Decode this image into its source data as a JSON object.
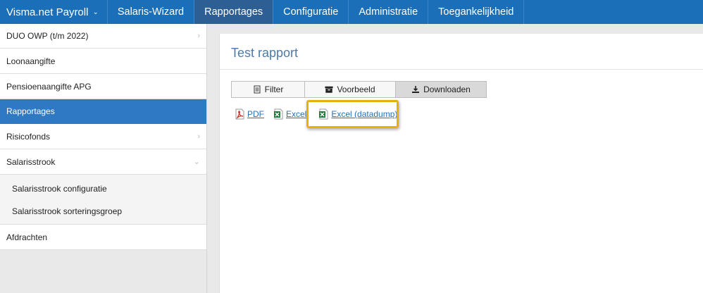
{
  "topnav": {
    "brand": "Visma.net Payroll",
    "items": [
      "Salaris-Wizard",
      "Rapportages",
      "Configuratie",
      "Administratie",
      "Toegankelijkheid"
    ],
    "active": "Rapportages"
  },
  "sidebar": {
    "items": [
      {
        "label": "DUO OWP (t/m 2022)",
        "caret": "›"
      },
      {
        "label": "Loonaangifte"
      },
      {
        "label": "Pensioenaangifte APG"
      },
      {
        "label": "Rapportages",
        "active": true
      },
      {
        "label": "Risicofonds",
        "caret": "›"
      },
      {
        "label": "Salarisstrook",
        "caret": "⌄"
      },
      {
        "label": "Afdrachten"
      }
    ],
    "subitems": [
      "Salarisstrook configuratie",
      "Salarisstrook sorteringsgroep"
    ]
  },
  "main": {
    "title": "Test rapport",
    "tabs": [
      {
        "label": "Filter",
        "icon": "document-icon"
      },
      {
        "label": "Voorbeeld",
        "icon": "archive-icon"
      },
      {
        "label": "Downloaden",
        "icon": "download-icon",
        "active": true
      }
    ],
    "downloads": [
      {
        "label": "PDF",
        "icon": "pdf-icon"
      },
      {
        "label": "Excel",
        "icon": "excel-icon"
      },
      {
        "label": "Excel (datadump)",
        "icon": "excel-icon",
        "highlighted": true
      }
    ]
  },
  "colors": {
    "nav_bg": "#1b6fb8",
    "nav_active": "#2d5f94",
    "sidebar_active": "#2f78c2",
    "link": "#2a6eb5",
    "highlight": "#e7b10a"
  }
}
